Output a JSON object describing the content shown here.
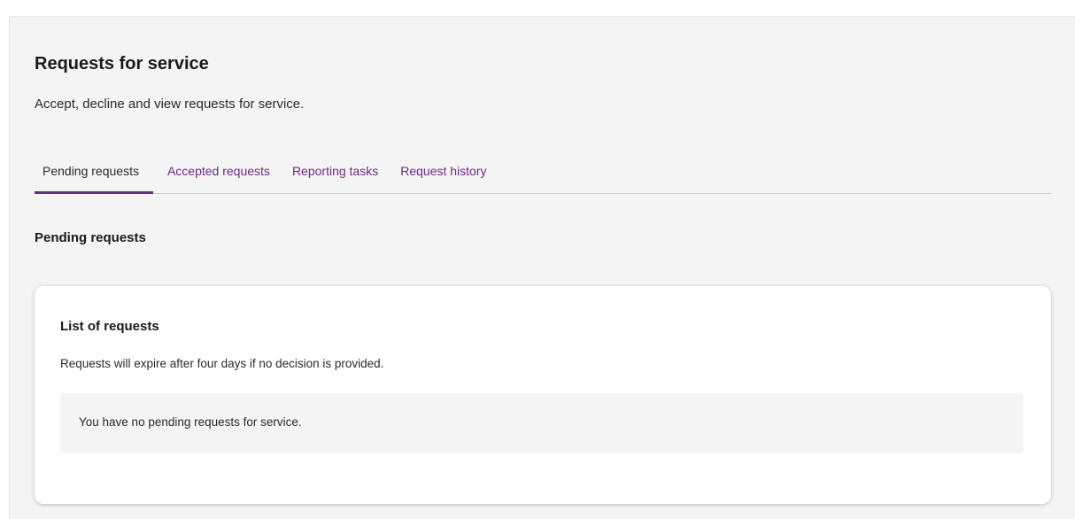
{
  "page": {
    "title": "Requests for service",
    "subtitle": "Accept, decline and view requests for service."
  },
  "tabs": [
    {
      "label": "Pending requests",
      "active": true
    },
    {
      "label": "Accepted requests",
      "active": false
    },
    {
      "label": "Reporting tasks",
      "active": false
    },
    {
      "label": "Request history",
      "active": false
    }
  ],
  "section": {
    "heading": "Pending requests"
  },
  "card": {
    "title": "List of requests",
    "description": "Requests will expire after four days if no decision is provided.",
    "empty_message": "You have no pending requests for service."
  },
  "colors": {
    "accent": "#6b2a8a",
    "page_background": "#f4f4f4",
    "card_background": "#ffffff"
  }
}
